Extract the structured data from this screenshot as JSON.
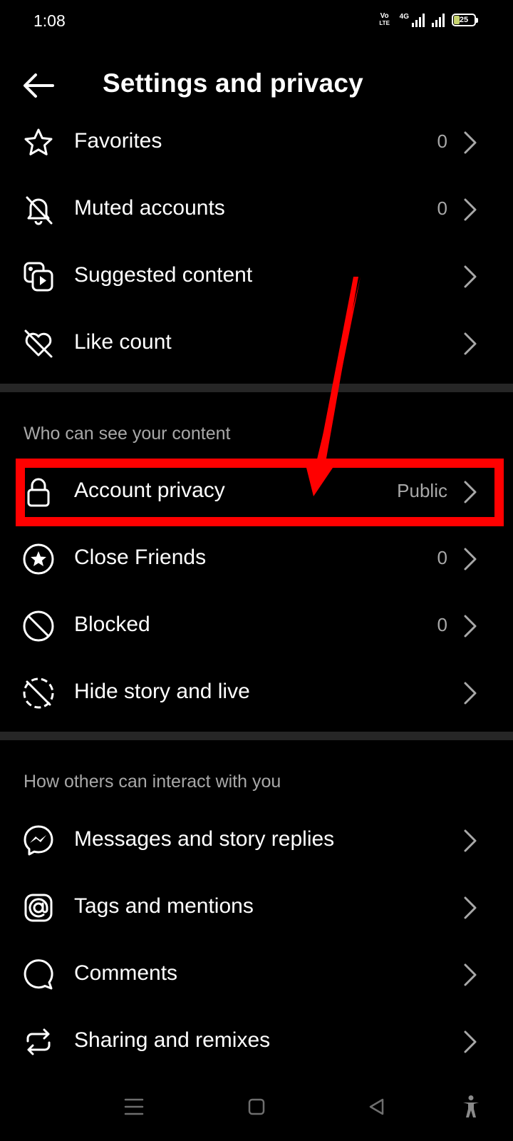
{
  "status_bar": {
    "time": "1:08",
    "volte_top": "Vo",
    "volte_bottom": "LTE",
    "network": "4G",
    "battery": "25"
  },
  "header": {
    "title": "Settings and privacy"
  },
  "rows_top": [
    {
      "label": "Favorites",
      "value": "0",
      "icon": "star-icon"
    },
    {
      "label": "Muted accounts",
      "value": "0",
      "icon": "muted-bell-icon"
    },
    {
      "label": "Suggested content",
      "value": "",
      "icon": "suggested-content-icon"
    },
    {
      "label": "Like count",
      "value": "",
      "icon": "heart-off-icon"
    }
  ],
  "section_visibility": {
    "title": "Who can see your content",
    "rows": [
      {
        "label": "Account privacy",
        "value": "Public",
        "icon": "lock-icon"
      },
      {
        "label": "Close Friends",
        "value": "0",
        "icon": "star-circle-icon"
      },
      {
        "label": "Blocked",
        "value": "0",
        "icon": "blocked-icon"
      },
      {
        "label": "Hide story and live",
        "value": "",
        "icon": "hide-story-icon"
      }
    ]
  },
  "section_interaction": {
    "title": "How others can interact with you",
    "rows": [
      {
        "label": "Messages and story replies",
        "value": "",
        "icon": "messenger-icon"
      },
      {
        "label": "Tags and mentions",
        "value": "",
        "icon": "at-sign-icon"
      },
      {
        "label": "Comments",
        "value": "",
        "icon": "comment-icon"
      },
      {
        "label": "Sharing and remixes",
        "value": "",
        "icon": "share-remix-icon"
      }
    ]
  },
  "annotation": {
    "highlight_color": "#ff0000",
    "highlighted_item": "Account privacy"
  },
  "colors": {
    "background": "#000000",
    "text": "#ffffff",
    "secondary_text": "#a8a8a8",
    "divider": "#262626"
  }
}
